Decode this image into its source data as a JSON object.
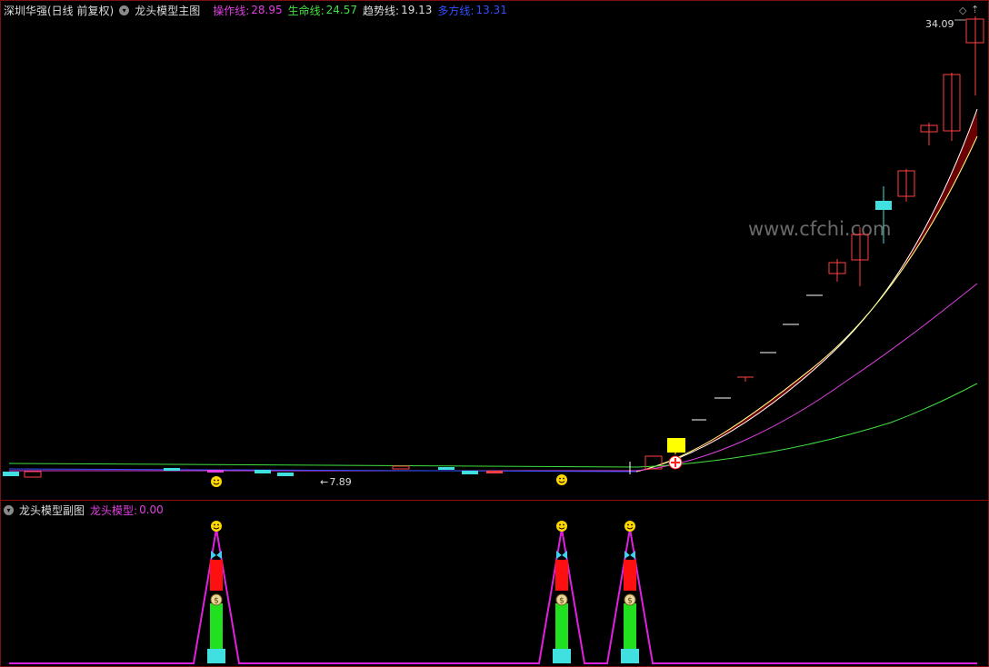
{
  "main_header": {
    "stock": "深圳华强(日线 前复权)",
    "indicator": "龙头模型主图",
    "lines": [
      {
        "label": "操作线:",
        "value": "28.95",
        "color": "#e040e0"
      },
      {
        "label": "生命线:",
        "value": "24.57",
        "color": "#40e040"
      },
      {
        "label": "趋势线:",
        "value": "19.13",
        "color": "#dddddd"
      },
      {
        "label": "多方线:",
        "value": "13.31",
        "color": "#3050ff"
      }
    ]
  },
  "sub_header": {
    "indicator": "龙头模型副图",
    "label": "龙头模型:",
    "value": "0.00",
    "color": "#e040e0"
  },
  "watermark": "www.cfchi.com",
  "price_max_label": "34.09",
  "price_min_label": "7.89",
  "icons": {
    "smiley": "smiley-icon",
    "butterfly": "butterfly-icon",
    "money_bag": "money-bag-icon",
    "cross": "red-cross-icon"
  },
  "colors": {
    "up_candle": "#ff4040",
    "down_candle": "#40e0e0",
    "band_fill": "#6b0000",
    "ma_magenta": "#e040e0",
    "ma_green": "#40e040",
    "sub_line": "#e020e0",
    "bar_cyan": "#40e0e0",
    "bar_green": "#20e020",
    "bar_red": "#ff1010",
    "signal_yellow": "#ffff00"
  }
}
